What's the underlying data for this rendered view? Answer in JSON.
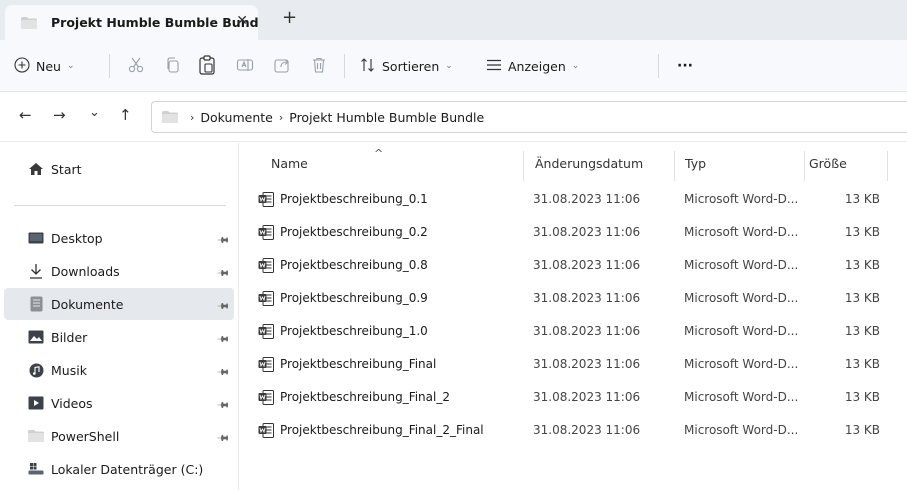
{
  "tab": {
    "title": "Projekt Humble Bumble Bund",
    "close_glyph": "✕",
    "new_tab_glyph": "+"
  },
  "toolbar": {
    "new_label": "Neu",
    "sort_label": "Sortieren",
    "view_label": "Anzeigen",
    "more_glyph": "···",
    "icons": [
      "plus-circle-icon",
      "cut-icon",
      "copy-icon",
      "paste-icon",
      "rename-icon",
      "share-icon",
      "delete-icon",
      "sort-icon",
      "view-icon"
    ]
  },
  "navigation": {
    "back_glyph": "←",
    "forward_glyph": "→",
    "recent_glyph": "⌄",
    "up_glyph": "↑"
  },
  "breadcrumb": {
    "separator": "›",
    "items": [
      "Dokumente",
      "Projekt Humble Bumble Bundle"
    ]
  },
  "sidebar": {
    "home": "Start",
    "items": [
      {
        "label": "Desktop",
        "icon": "desktop-icon",
        "pinned": true
      },
      {
        "label": "Downloads",
        "icon": "download-icon",
        "pinned": true
      },
      {
        "label": "Dokumente",
        "icon": "documents-icon",
        "pinned": true,
        "selected": true
      },
      {
        "label": "Bilder",
        "icon": "pictures-icon",
        "pinned": true
      },
      {
        "label": "Musik",
        "icon": "music-icon",
        "pinned": true
      },
      {
        "label": "Videos",
        "icon": "videos-icon",
        "pinned": true
      },
      {
        "label": "PowerShell",
        "icon": "folder-icon",
        "pinned": true
      },
      {
        "label": "Lokaler Datenträger (C:)",
        "icon": "drive-icon",
        "pinned": false
      }
    ]
  },
  "columns": {
    "name": "Name",
    "date": "Änderungsdatum",
    "type": "Typ",
    "size": "Größe",
    "sort_glyph": "^"
  },
  "files": [
    {
      "name": "Projektbeschreibung_0.1",
      "date": "31.08.2023 11:06",
      "type": "Microsoft Word-D...",
      "size": "13 KB"
    },
    {
      "name": "Projektbeschreibung_0.2",
      "date": "31.08.2023 11:06",
      "type": "Microsoft Word-D...",
      "size": "13 KB"
    },
    {
      "name": "Projektbeschreibung_0.8",
      "date": "31.08.2023 11:06",
      "type": "Microsoft Word-D...",
      "size": "13 KB"
    },
    {
      "name": "Projektbeschreibung_0.9",
      "date": "31.08.2023 11:06",
      "type": "Microsoft Word-D...",
      "size": "13 KB"
    },
    {
      "name": "Projektbeschreibung_1.0",
      "date": "31.08.2023 11:06",
      "type": "Microsoft Word-D...",
      "size": "13 KB"
    },
    {
      "name": "Projektbeschreibung_Final",
      "date": "31.08.2023 11:06",
      "type": "Microsoft Word-D...",
      "size": "13 KB"
    },
    {
      "name": "Projektbeschreibung_Final_2",
      "date": "31.08.2023 11:06",
      "type": "Microsoft Word-D...",
      "size": "13 KB"
    },
    {
      "name": "Projektbeschreibung_Final_2_Final",
      "date": "31.08.2023 11:06",
      "type": "Microsoft Word-D...",
      "size": "13 KB"
    }
  ],
  "colors": {
    "accent": "#0067c0",
    "word_blue": "#185abd",
    "selection": "#e5e8ed",
    "folder": "#dcdcdc"
  }
}
